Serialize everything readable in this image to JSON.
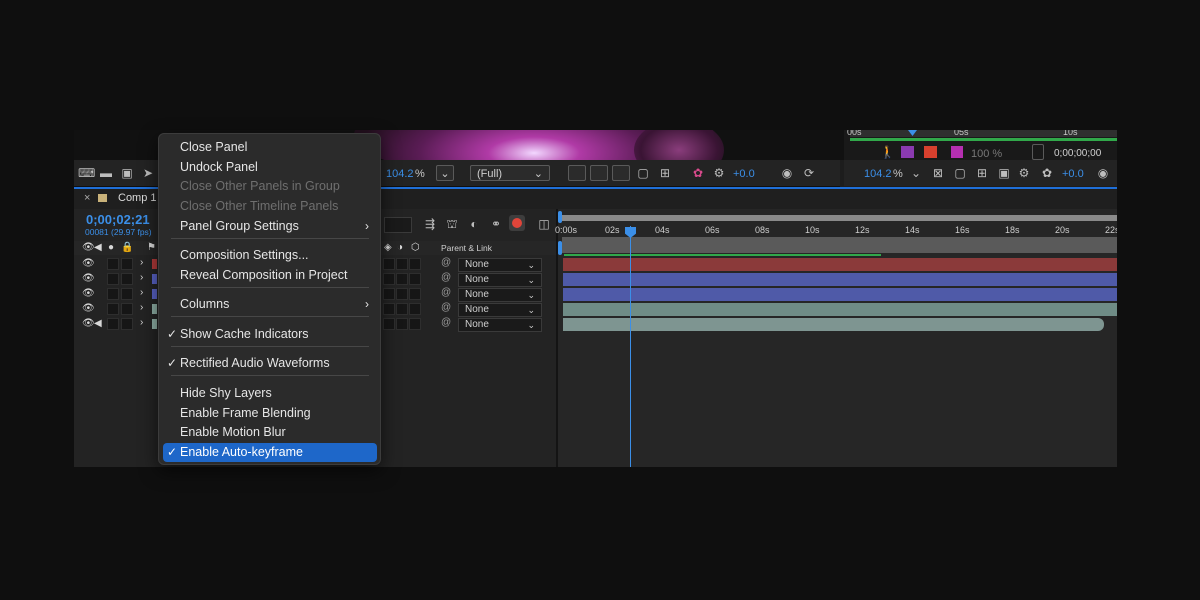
{
  "viewer": {
    "zoom_left": "104.2",
    "zoom_unit": "%",
    "resolution": "(Full)",
    "exposure_left": "+0.0",
    "zoom_right": "104.2",
    "exposure_right": "+0.0",
    "mini_ticks": [
      "00s",
      "05s",
      "10s"
    ],
    "mini_percent": "100 %",
    "mini_timecode": "0;00;00;00"
  },
  "timeline": {
    "tab_label": "Comp 1",
    "timecode": "0;00;02;21",
    "frame_info": "00081 (29.97 fps)",
    "parent_link_header": "Parent & Link",
    "ruler_ticks": [
      "0:00s",
      "02s",
      "04s",
      "06s",
      "08s",
      "10s",
      "12s",
      "14s",
      "16s",
      "18s",
      "20s",
      "22s"
    ],
    "layers": [
      {
        "parent": "None",
        "color": "#b23a3a",
        "bar": "#8b3a3a"
      },
      {
        "parent": "None",
        "color": "#5a63c6",
        "bar": "#4f5aa8"
      },
      {
        "parent": "None",
        "color": "#5a63c6",
        "bar": "#4f5aa8"
      },
      {
        "parent": "None",
        "color": "#8fb0a6",
        "bar": "#6f8c86"
      },
      {
        "parent": "None",
        "color": "#8fb0a6",
        "bar": "#7e9591"
      }
    ]
  },
  "menu": {
    "items": [
      {
        "label": "Close Panel",
        "disabled": false,
        "checked": false,
        "submenu": false
      },
      {
        "label": "Undock Panel",
        "disabled": false,
        "checked": false,
        "submenu": false
      },
      {
        "label": "Close Other Panels in Group",
        "disabled": true,
        "checked": false,
        "submenu": false
      },
      {
        "label": "Close Other Timeline Panels",
        "disabled": true,
        "checked": false,
        "submenu": false
      },
      {
        "label": "Panel Group Settings",
        "disabled": false,
        "checked": false,
        "submenu": true
      },
      {
        "label": "Composition Settings...",
        "disabled": false,
        "checked": false,
        "submenu": false
      },
      {
        "label": "Reveal Composition in Project",
        "disabled": false,
        "checked": false,
        "submenu": false
      },
      {
        "label": "Columns",
        "disabled": false,
        "checked": false,
        "submenu": true
      },
      {
        "label": "Show Cache Indicators",
        "disabled": false,
        "checked": true,
        "submenu": false
      },
      {
        "label": "Rectified Audio Waveforms",
        "disabled": false,
        "checked": true,
        "submenu": false
      },
      {
        "label": "Hide Shy Layers",
        "disabled": false,
        "checked": false,
        "submenu": false
      },
      {
        "label": "Enable Frame Blending",
        "disabled": false,
        "checked": false,
        "submenu": false
      },
      {
        "label": "Enable Motion Blur",
        "disabled": false,
        "checked": false,
        "submenu": false
      },
      {
        "label": "Enable Auto-keyframe",
        "disabled": false,
        "checked": true,
        "submenu": false,
        "selected": true
      }
    ],
    "check_glyph": "✓",
    "submenu_glyph": "›"
  }
}
